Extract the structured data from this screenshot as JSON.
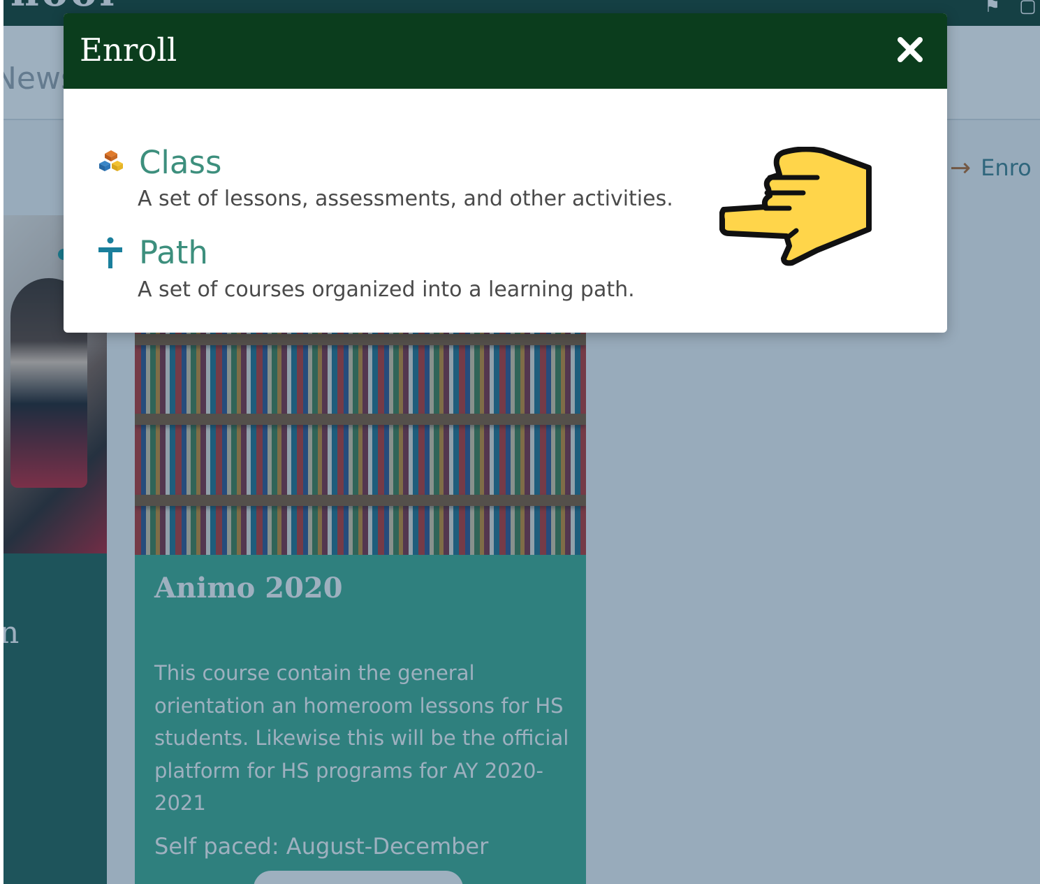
{
  "background": {
    "school_name": "hool",
    "nav_tab": "News",
    "enroll_link": "Enro",
    "left_panel_letter": "n",
    "course": {
      "title": "Animo 2020",
      "description": "This course contain the general orientation an homeroom lessons for HS students. Likewise this will be the official platform for HS programs for AY 2020-2021",
      "schedule": "Self paced: August-December"
    }
  },
  "modal": {
    "title": "Enroll",
    "close_icon": "close-icon",
    "options": [
      {
        "label": "Class",
        "description": "A set of lessons, assessments, and other activities.",
        "icon": "cubes-icon"
      },
      {
        "label": "Path",
        "description": "A set of courses organized into a learning path.",
        "icon": "signpost-icon"
      }
    ]
  },
  "annotation": {
    "icon": "pointing-hand-icon",
    "color": "#ffd54a"
  },
  "colors": {
    "modal_header": "#0b3d1d",
    "option_label": "#3d8f7d",
    "course_card": "#3cab8e",
    "topbar": "#0f3a28",
    "overlay": "#1e486a"
  }
}
